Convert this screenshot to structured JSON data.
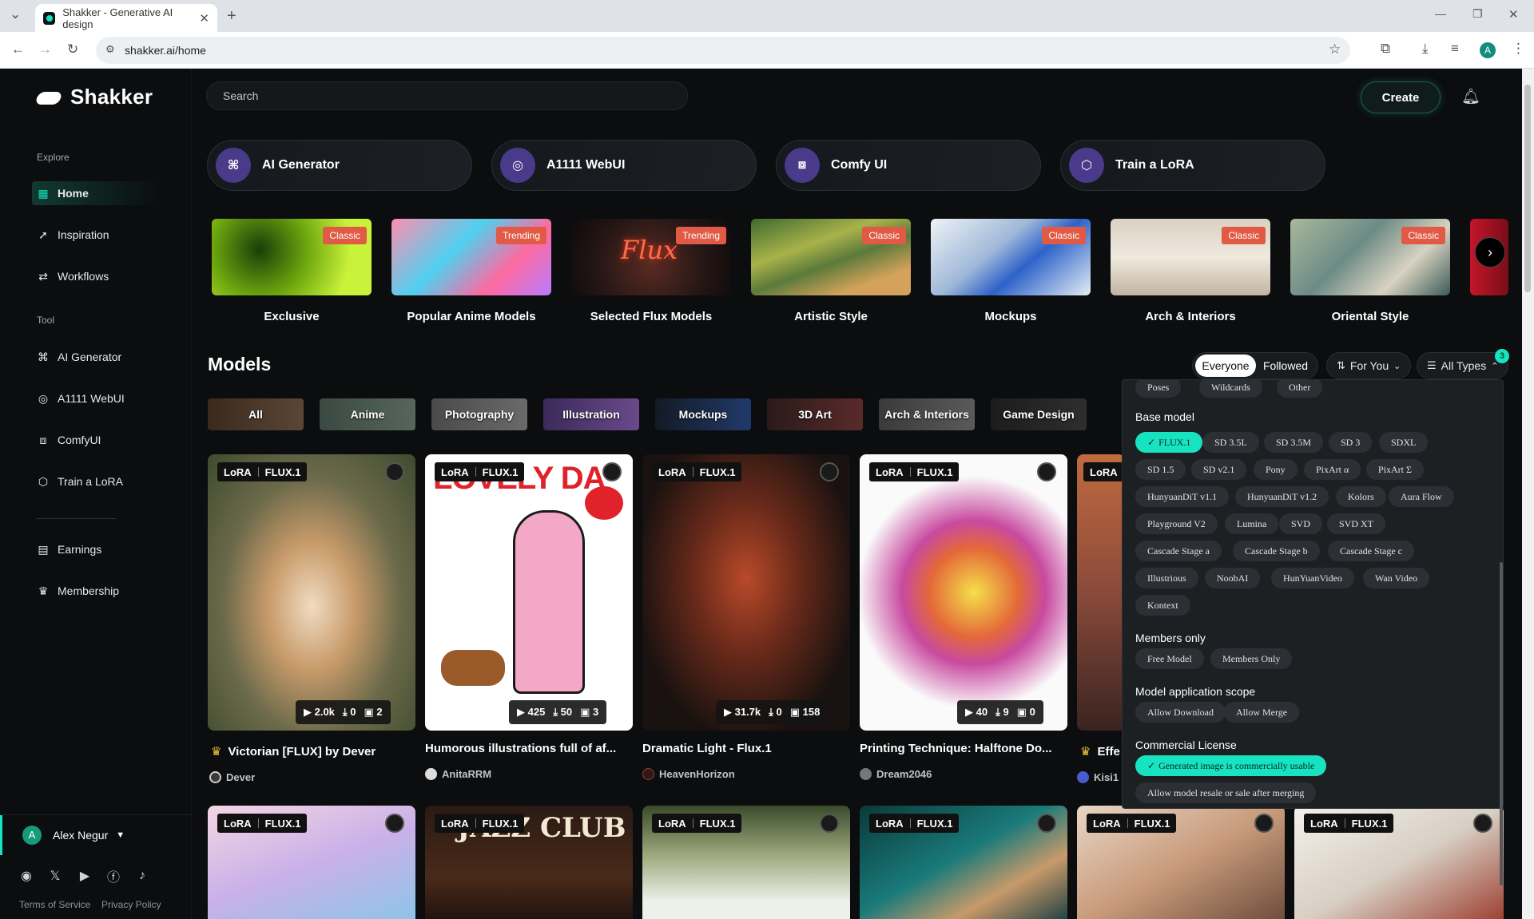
{
  "browser": {
    "tab_title": "Shakker - Generative AI design",
    "url": "shakker.ai/home",
    "profile_initial": "A"
  },
  "app": {
    "brand": "Shakker",
    "accent": "#18e3c0",
    "search_placeholder": "Search",
    "create_label": "Create"
  },
  "sidebar": {
    "explore_label": "Explore",
    "explore_items": [
      "Home",
      "Inspiration",
      "Workflows"
    ],
    "tool_label": "Tool",
    "tool_items": [
      "AI Generator",
      "A1111 WebUI",
      "ComfyUI",
      "Train a LoRA"
    ],
    "extra_items": [
      "Earnings",
      "Membership"
    ],
    "user_name": "Alex Negur",
    "user_initial": "A",
    "terms": "Terms of Service",
    "privacy": "Privacy Policy"
  },
  "quick_tools": [
    "AI Generator",
    "A1111 WebUI",
    "Comfy UI",
    "Train a LoRA"
  ],
  "categories": [
    {
      "label": "Exclusive",
      "badge": "Classic"
    },
    {
      "label": "Popular Anime Models",
      "badge": "Trending"
    },
    {
      "label": "Selected Flux Models",
      "badge": "Trending"
    },
    {
      "label": "Artistic Style",
      "badge": "Classic"
    },
    {
      "label": "Mockups",
      "badge": "Classic"
    },
    {
      "label": "Arch & Interiors",
      "badge": "Classic"
    },
    {
      "label": "Oriental Style",
      "badge": "Classic"
    }
  ],
  "flux_text": "Flux",
  "models": {
    "title": "Models",
    "audience": [
      "Everyone",
      "Followed"
    ],
    "sort": "For You",
    "types": "All Types",
    "types_count": "3",
    "chips": [
      "All",
      "Anime",
      "Photography",
      "Illustration",
      "Mockups",
      "3D Art",
      "Arch & Interiors",
      "Game Design"
    ]
  },
  "cards": [
    {
      "tag1": "LoRA",
      "tag2": "FLUX.1",
      "runs": "2.0k",
      "downloads": "0",
      "images": "2",
      "title": "Victorian [FLUX] by Dever",
      "author": "Dever"
    },
    {
      "tag1": "LoRA",
      "tag2": "FLUX.1",
      "runs": "425",
      "downloads": "50",
      "images": "3",
      "title": "Humorous illustrations full of af...",
      "author": "AnitaRRM",
      "poster_text": "LOVELY DA"
    },
    {
      "tag1": "LoRA",
      "tag2": "FLUX.1",
      "runs": "31.7k",
      "downloads": "0",
      "images": "158",
      "title": "Dramatic Light - Flux.1",
      "author": "HeavenHorizon"
    },
    {
      "tag1": "LoRA",
      "tag2": "FLUX.1",
      "runs": "40",
      "downloads": "9",
      "images": "0",
      "title": "Printing Technique: Halftone Do...",
      "author": "Dream2046"
    },
    {
      "tag1": "LoRA",
      "tag2": "",
      "title": "Effe",
      "author": "Kisi1"
    }
  ],
  "row2_cards": [
    {
      "tag1": "LoRA",
      "tag2": "FLUX.1"
    },
    {
      "tag1": "LoRA",
      "tag2": "FLUX.1",
      "poster_text": "JAZZ CLUB"
    },
    {
      "tag1": "LoRA",
      "tag2": "FLUX.1"
    },
    {
      "tag1": "LoRA",
      "tag2": "FLUX.1"
    },
    {
      "tag1": "LoRA",
      "tag2": "FLUX.1"
    },
    {
      "tag1": "LoRA",
      "tag2": "FLUX.1"
    }
  ],
  "filters": {
    "type_options": [
      "Poses",
      "Wildcards",
      "Other"
    ],
    "base_model_label": "Base model",
    "base_models": [
      "FLUX.1",
      "SD 3.5L",
      "SD 3.5M",
      "SD 3",
      "SDXL",
      "SD 1.5",
      "SD v2.1",
      "Pony",
      "PixArt α",
      "PixArt Σ",
      "HunyuanDiT v1.1",
      "HunyuanDiT v1.2",
      "Kolors",
      "Aura Flow",
      "Playground V2",
      "Lumina",
      "SVD",
      "SVD XT",
      "Cascade Stage a",
      "Cascade Stage b",
      "Cascade Stage c",
      "Illustrious",
      "NoobAI",
      "HunYuanVideo",
      "Wan Video",
      "Kontext"
    ],
    "members_label": "Members only",
    "members": [
      "Free Model",
      "Members Only"
    ],
    "scope_label": "Model application scope",
    "scope": [
      "Allow Download",
      "Allow Merge"
    ],
    "license_label": "Commercial License",
    "license": [
      "Generated image is commercially usable",
      "Allow model resale or sale after merging"
    ]
  }
}
